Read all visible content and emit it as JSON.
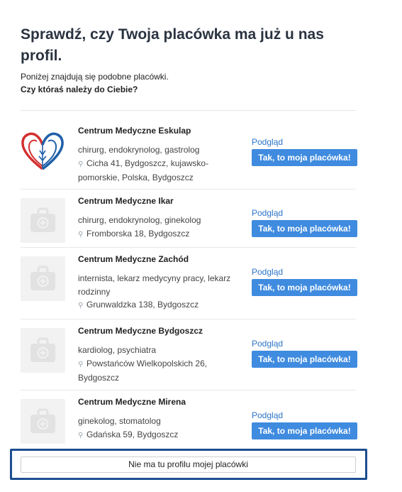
{
  "title": "Sprawdź, czy Twoja placówka ma już u nas profil.",
  "intro": {
    "line1": "Poniżej znajdują się podobne placówki.",
    "line2": "Czy któraś należy do Ciebie?"
  },
  "preview_label": "Podgląd",
  "claim_label": "Tak, to moja placówka!",
  "facilities": [
    {
      "name": "Centrum Medyczne Eskulap",
      "specialties": "chirurg, endokrynolog, gastrolog",
      "address": "Cicha 41, Bydgoszcz, kujawsko-pomorskie, Polska, Bydgoszcz",
      "icon": "heart-logo"
    },
    {
      "name": "Centrum Medyczne Ikar",
      "specialties": "chirurg, endokrynolog, ginekolog",
      "address": "Fromborska 18, Bydgoszcz",
      "icon": "medical-bag-placeholder"
    },
    {
      "name": "Centrum Medyczne Zachód",
      "specialties": "internista, lekarz medycyny pracy, lekarz rodzinny",
      "address": "Grunwaldzka 138, Bydgoszcz",
      "icon": "medical-bag-placeholder"
    },
    {
      "name": "Centrum Medyczne Bydgoszcz",
      "specialties": "kardiolog, psychiatra",
      "address": "Powstańców Wielkopolskich 26, Bydgoszcz",
      "icon": "medical-bag-placeholder"
    },
    {
      "name": "Centrum Medyczne Mirena",
      "specialties": "ginekolog, stomatolog",
      "address": "Gdańska 59, Bydgoszcz",
      "icon": "medical-bag-placeholder"
    }
  ],
  "none_button_label": "Nie ma tu profilu mojej placówki",
  "colors": {
    "primary": "#3f8bdf",
    "link": "#2b74c7",
    "focus": "#1d4e8f",
    "title": "#2a3340"
  }
}
